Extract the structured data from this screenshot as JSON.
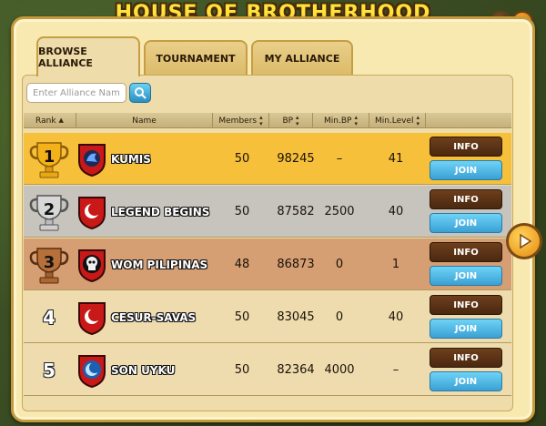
{
  "window": {
    "title": "HOUSE OF BROTHERHOOD",
    "help_label": "?",
    "close_label": "×"
  },
  "tabs": [
    {
      "label": "Browse Alliance",
      "active": true
    },
    {
      "label": "Tournament",
      "active": false
    },
    {
      "label": "My Alliance",
      "active": false
    }
  ],
  "search": {
    "placeholder": "Enter Alliance Name",
    "value": "",
    "icon": "search-icon"
  },
  "table": {
    "columns": [
      "Rank",
      "Name",
      "Members",
      "BP",
      "Min.BP",
      "Min.Level"
    ],
    "rows": [
      {
        "rank": "1",
        "trophy": "gold",
        "name": "KUMIS",
        "emblem_color": "#c81818",
        "emblem_icon": "dragon",
        "members": "50",
        "bp": "98245",
        "min_bp": "–",
        "min_level": "41"
      },
      {
        "rank": "2",
        "trophy": "silver",
        "name": "LEGEND BEGINS",
        "emblem_color": "#c81818",
        "emblem_icon": "crescent",
        "members": "50",
        "bp": "87582",
        "min_bp": "2500",
        "min_level": "40"
      },
      {
        "rank": "3",
        "trophy": "bronze",
        "name": "WOM PILIPINAS",
        "emblem_color": "#c81818",
        "emblem_icon": "skull",
        "members": "48",
        "bp": "86873",
        "min_bp": "0",
        "min_level": "1"
      },
      {
        "rank": "4",
        "trophy": "none",
        "name": "CESUR-SAVAS",
        "emblem_color": "#c81818",
        "emblem_icon": "crescent",
        "members": "50",
        "bp": "83045",
        "min_bp": "0",
        "min_level": "40"
      },
      {
        "rank": "5",
        "trophy": "none",
        "name": "SON UYKU",
        "emblem_color": "#c81818",
        "emblem_icon": "crescent-blue",
        "members": "50",
        "bp": "82364",
        "min_bp": "4000",
        "min_level": "–"
      }
    ],
    "info_label": "INFO",
    "join_label": "JOIN"
  },
  "colors": {
    "gold_row": "#f6c03a",
    "silver_row": "#c7c4bd",
    "bronze_row": "#d59f73",
    "default_row": "#efdcae",
    "title": "#ffe23a"
  },
  "next_icon": "play-arrow-icon"
}
